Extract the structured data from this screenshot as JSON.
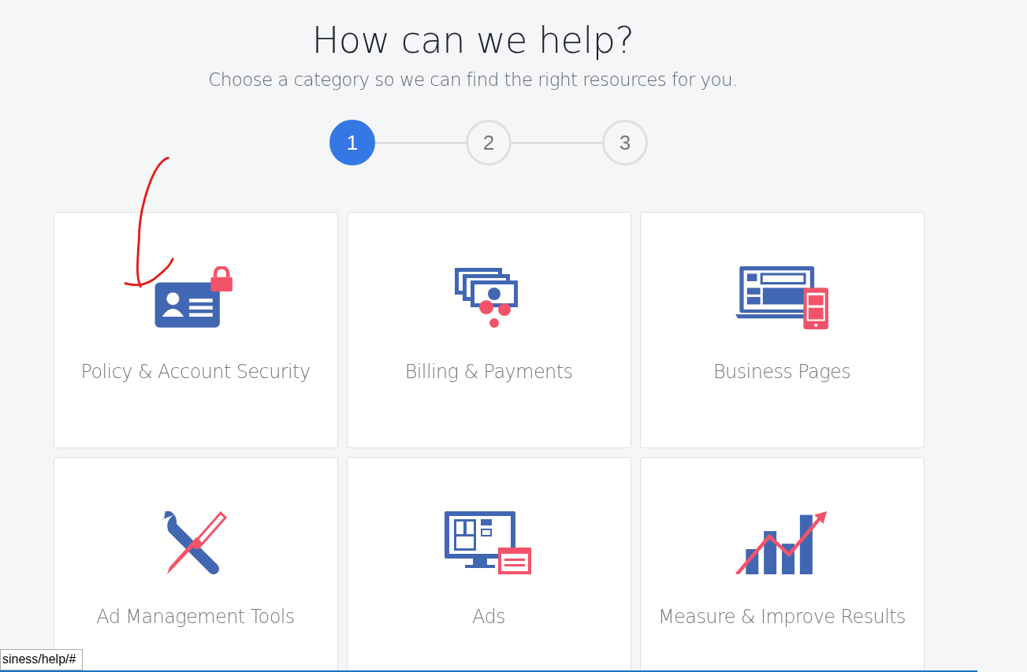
{
  "header": {
    "title": "How can we help?",
    "subtitle": "Choose a category so we can find the right resources for you."
  },
  "steps": [
    {
      "label": "1",
      "selected": true
    },
    {
      "label": "2",
      "selected": false
    },
    {
      "label": "3",
      "selected": false
    }
  ],
  "categories": [
    {
      "kind": "security",
      "label": "Policy & Account Security"
    },
    {
      "kind": "billing",
      "label": "Billing & Payments"
    },
    {
      "kind": "pages",
      "label": "Business Pages"
    },
    {
      "kind": "tools",
      "label": "Ad Management Tools"
    },
    {
      "kind": "ads",
      "label": "Ads"
    },
    {
      "kind": "results",
      "label": "Measure & Improve Results"
    }
  ],
  "status_tooltip": "siness/help/#"
}
